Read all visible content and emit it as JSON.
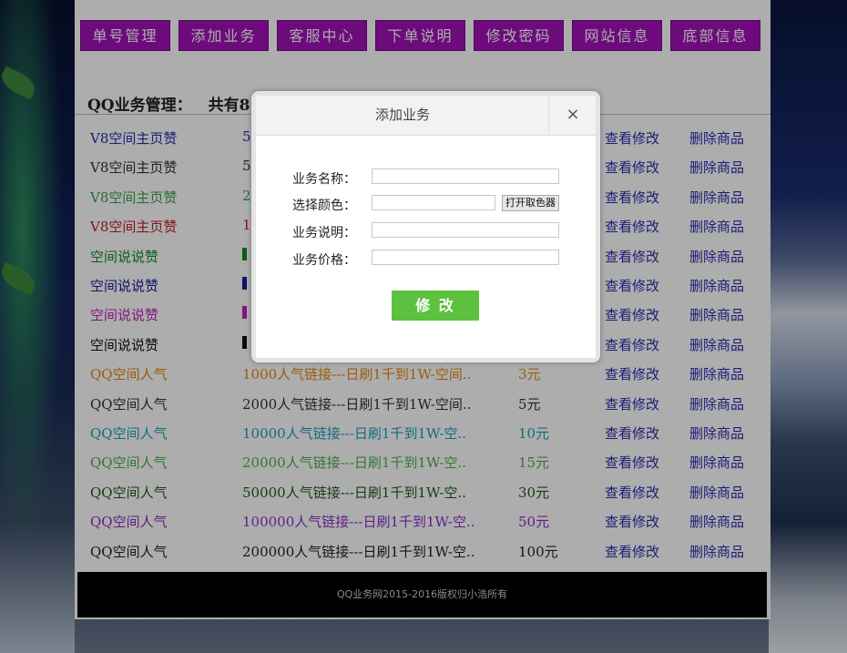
{
  "nav": [
    "单号管理",
    "添加业务",
    "客服中心",
    "下单说明",
    "修改密码",
    "网站信息",
    "底部信息"
  ],
  "heading": {
    "title": "QQ业务管理：",
    "count": "共有8"
  },
  "rows": [
    {
      "name": "V8空间主页赞",
      "desc": "5(",
      "price": "",
      "color": "#2a2ab0",
      "swatch": "",
      "edit": "查看修改",
      "del": "删除商品"
    },
    {
      "name": "V8空间主页赞",
      "desc": "5(",
      "price": "",
      "color": "#333333",
      "swatch": "",
      "edit": "查看修改",
      "del": "删除商品"
    },
    {
      "name": "V8空间主页赞",
      "desc": "2(",
      "price": "",
      "color": "#3aa04a",
      "swatch": "",
      "edit": "查看修改",
      "del": "删除商品"
    },
    {
      "name": "V8空间主页赞",
      "desc": "1(",
      "price": "",
      "color": "#c02030",
      "swatch": "",
      "edit": "查看修改",
      "del": "删除商品"
    },
    {
      "name": "空间说说赞",
      "desc": "",
      "price": "",
      "color": "#138a20",
      "swatch": "#138a20",
      "edit": "查看修改",
      "del": "删除商品"
    },
    {
      "name": "空间说说赞",
      "desc": "",
      "price": "",
      "color": "#1a1aa0",
      "swatch": "#1a1aa0",
      "edit": "查看修改",
      "del": "删除商品"
    },
    {
      "name": "空间说说赞",
      "desc": "",
      "price": "",
      "color": "#c020c0",
      "swatch": "#c020c0",
      "edit": "查看修改",
      "del": "删除商品"
    },
    {
      "name": "空间说说赞",
      "desc": "",
      "price": "",
      "color": "#111111",
      "swatch": "#111111",
      "edit": "查看修改",
      "del": "删除商品"
    },
    {
      "name": "QQ空间人气",
      "desc": "1000人气链接---日刷1千到1W-空间..",
      "price": "3元",
      "color": "#e08a10",
      "swatch": "",
      "edit": "查看修改",
      "del": "删除商品"
    },
    {
      "name": "QQ空间人气",
      "desc": "2000人气链接---日刷1千到1W-空间..",
      "price": "5元",
      "color": "#333333",
      "swatch": "",
      "edit": "查看修改",
      "del": "删除商品"
    },
    {
      "name": "QQ空间人气",
      "desc": "10000人气链接---日刷1千到1W-空..",
      "price": "10元",
      "color": "#1aa0c0",
      "swatch": "",
      "edit": "查看修改",
      "del": "删除商品"
    },
    {
      "name": "QQ空间人气",
      "desc": "20000人气链接---日刷1千到1W-空..",
      "price": "15元",
      "color": "#4ab04a",
      "swatch": "",
      "edit": "查看修改",
      "del": "删除商品"
    },
    {
      "name": "QQ空间人气",
      "desc": "50000人气链接---日刷1千到1W-空..",
      "price": "30元",
      "color": "#1f5a1f",
      "swatch": "",
      "edit": "查看修改",
      "del": "删除商品"
    },
    {
      "name": "QQ空间人气",
      "desc": "100000人气链接---日刷1千到1W-空..",
      "price": "50元",
      "color": "#8a30c8",
      "swatch": "",
      "edit": "查看修改",
      "del": "删除商品"
    },
    {
      "name": "QQ空间人气",
      "desc": "200000人气链接---日刷1千到1W-空..",
      "price": "100元",
      "color": "#222222",
      "swatch": "",
      "edit": "查看修改",
      "del": "删除商品"
    }
  ],
  "footer": "QQ业务网2015-2016版权归小浩所有",
  "dialog": {
    "title": "添加业务",
    "close": "×",
    "labels": {
      "name": "业务名称：",
      "color": "选择颜色：",
      "desc": "业务说明：",
      "price": "业务价格："
    },
    "values": {
      "name": "",
      "color": "",
      "desc": "",
      "price": ""
    },
    "picker": "打开取色器",
    "submit": "修 改"
  },
  "colors": {
    "nav_bg": "#a111b8",
    "submit_bg": "#5cc13e",
    "link": "#2a2ab0"
  }
}
